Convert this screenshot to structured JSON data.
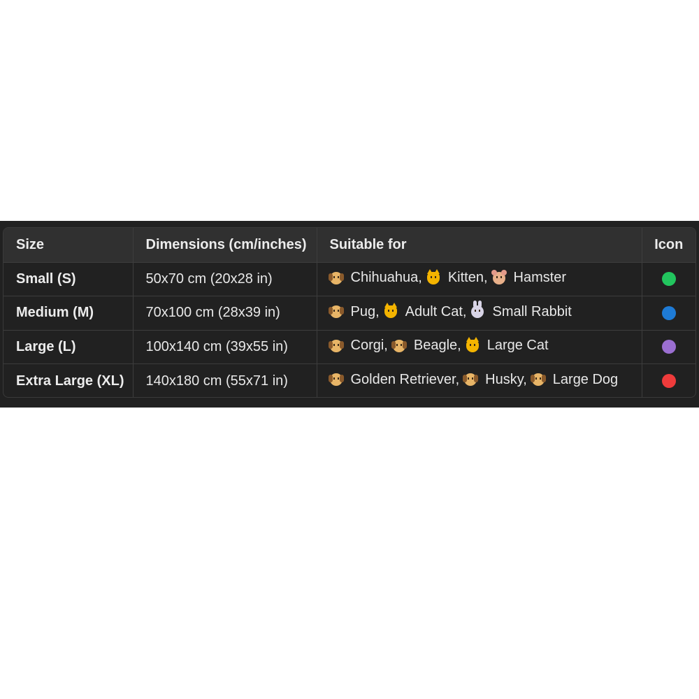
{
  "table": {
    "headers": [
      "Size",
      "Dimensions (cm/inches)",
      "Suitable for",
      "Icon"
    ],
    "rows": [
      {
        "size": "Small (S)",
        "dimensions": "50x70 cm (20x28 in)",
        "pets": [
          {
            "icon": "dog-face-icon",
            "name": "Chihuahua,"
          },
          {
            "icon": "cat-face-icon",
            "name": "Kitten,"
          },
          {
            "icon": "hamster-face-icon",
            "name": "Hamster"
          }
        ],
        "icon": {
          "name": "green-circle-icon",
          "color": "#22c55e"
        }
      },
      {
        "size": "Medium (M)",
        "dimensions": "70x100 cm (28x39 in)",
        "pets": [
          {
            "icon": "dog-face-icon",
            "name": "Pug,"
          },
          {
            "icon": "cat-face-icon",
            "name": "Adult Cat,"
          },
          {
            "icon": "rabbit-face-icon",
            "name": "Small Rabbit"
          }
        ],
        "icon": {
          "name": "blue-circle-icon",
          "color": "#1e7bd6"
        }
      },
      {
        "size": "Large (L)",
        "dimensions": "100x140 cm (39x55 in)",
        "pets": [
          {
            "icon": "dog-face-icon",
            "name": "Corgi,"
          },
          {
            "icon": "dog-face-icon",
            "name": "Beagle,"
          },
          {
            "icon": "cat-face-icon",
            "name": "Large Cat"
          }
        ],
        "icon": {
          "name": "purple-circle-icon",
          "color": "#9b6fd1"
        }
      },
      {
        "size": "Extra Large (XL)",
        "dimensions": "140x180 cm (55x71 in)",
        "pets": [
          {
            "icon": "dog-face-icon",
            "name": "Golden Retriever,"
          },
          {
            "icon": "dog-face-icon",
            "name": "Husky,"
          },
          {
            "icon": "dog-face-icon",
            "name": "Large Dog"
          }
        ],
        "icon": {
          "name": "red-circle-icon",
          "color": "#ef3b3b"
        }
      }
    ]
  }
}
